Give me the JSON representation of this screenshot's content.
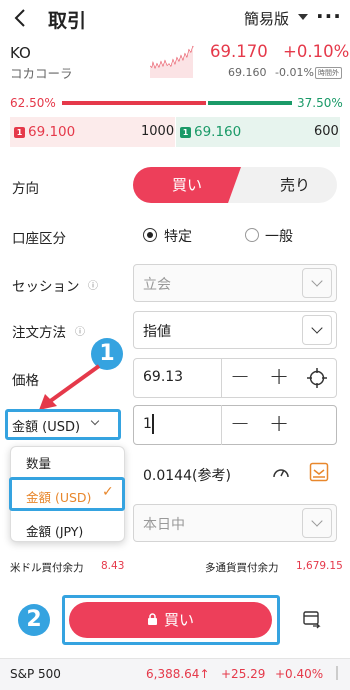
{
  "header": {
    "title": "取引",
    "mode": "簡易版",
    "more": "···"
  },
  "ticker": {
    "symbol": "KO",
    "name": "コカコーラ",
    "price": "69.170",
    "change_pct": "+0.10%",
    "sub_price": "69.160",
    "sub_pct": "-0.01%",
    "sub_badge": "時間外"
  },
  "ratio": {
    "buy": "62.50%",
    "sell": "37.50%",
    "buy_fraction": 0.625
  },
  "book": {
    "bid_tag": "1",
    "bid_price": "69.100",
    "bid_qty": "1000",
    "ask_tag": "1",
    "ask_price": "69.160",
    "ask_qty": "600"
  },
  "form": {
    "direction_label": "方向",
    "buy": "買い",
    "sell": "売り",
    "account_label": "口座区分",
    "account_opt1": "特定",
    "account_opt2": "一般",
    "session_label": "セッション",
    "session_value": "立会",
    "order_label": "注文方法",
    "order_value": "指値",
    "price_label": "価格",
    "price_value": "69.13",
    "amount_label": "金額 (USD)",
    "amount_value": "1",
    "ref_value": "0.0144(参考)",
    "expiry_value": "本日中"
  },
  "dropdown": {
    "opt1": "数量",
    "opt2": "金額 (USD)",
    "opt3": "金額 (JPY)",
    "selected": "金額 (USD)"
  },
  "funds": {
    "usd_label": "米ドル買付余力",
    "usd_value": "8.43",
    "multi_label": "多通貨買付余力",
    "multi_value": "1,679.15"
  },
  "annotations": {
    "num1": "1",
    "num2": "2"
  },
  "buy_button": "買い",
  "footer": {
    "index": "S&P 500",
    "value": "6,388.64↑",
    "change": "+25.29",
    "pct": "+0.40%"
  },
  "colors": {
    "buy_red": "#ed3f5a",
    "green": "#1a9a68",
    "highlight": "#35a3e0",
    "orange": "#e8872c"
  }
}
